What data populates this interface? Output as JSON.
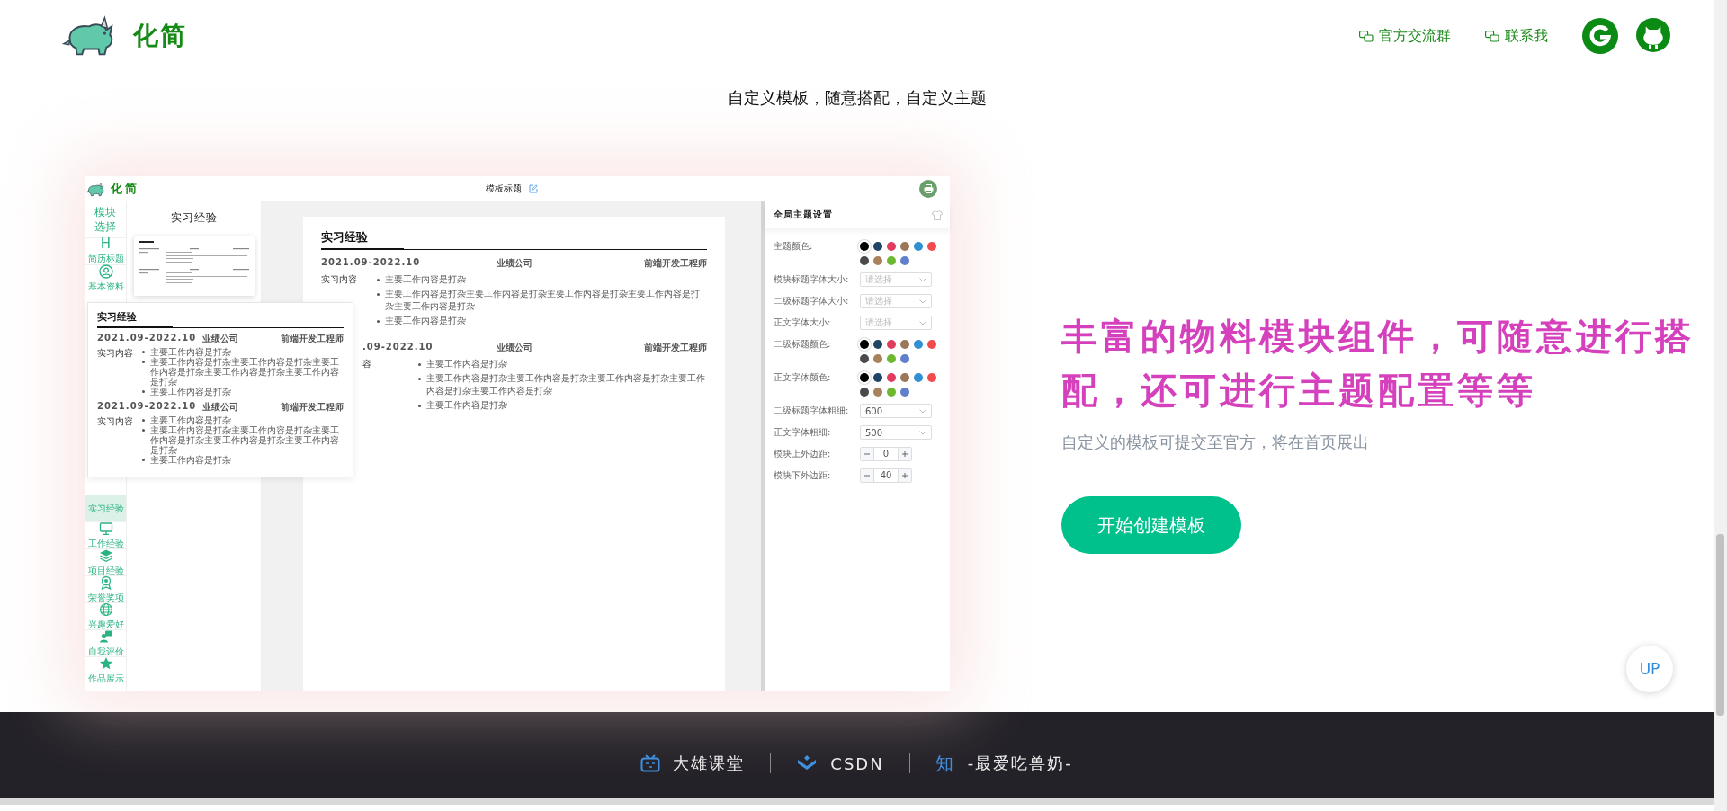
{
  "header": {
    "logo_text": "化简",
    "links": [
      {
        "label": "官方交流群"
      },
      {
        "label": "联系我"
      }
    ]
  },
  "tagline": "自定义模板，随意搭配，自定义主题",
  "preview": {
    "logo_text": "化简",
    "template_title": "模板标题",
    "sidebar": {
      "heading": "模块选择",
      "groups": [
        [
          {
            "kind": "glyph",
            "glyph": "H",
            "label": "简历标题",
            "selected": false
          },
          {
            "kind": "person",
            "label": "基本资料",
            "selected": false
          }
        ],
        [
          {
            "kind": "none",
            "label": "实习经验",
            "selected": true
          },
          {
            "kind": "monitor",
            "label": "工作经验",
            "selected": false
          },
          {
            "kind": "layers",
            "label": "项目经验",
            "selected": false
          },
          {
            "kind": "award",
            "label": "荣誉奖项",
            "selected": false
          },
          {
            "kind": "globe",
            "label": "兴趣爱好",
            "selected": false
          },
          {
            "kind": "chat",
            "label": "自我评价",
            "selected": false
          },
          {
            "kind": "star",
            "label": "作品展示",
            "selected": false
          }
        ]
      ]
    },
    "module_panel": {
      "title": "实习经验"
    },
    "document": {
      "heading": "实习经验",
      "entries": [
        {
          "period": "2021.09-2022.10",
          "company": "业绩公司",
          "role": "前端开发工程师",
          "label": "实习内容",
          "partly_hidden": false,
          "bullets": [
            "主要工作内容是打杂",
            "主要工作内容是打杂主要工作内容是打杂主要工作内容是打杂主要工作内容是打杂主要工作内容是打杂",
            "主要工作内容是打杂"
          ]
        },
        {
          "period": ".09-2022.10",
          "company": "业绩公司",
          "role": "前端开发工程师",
          "label": "容",
          "partly_hidden": true,
          "bullets": [
            "主要工作内容是打杂",
            "主要工作内容是打杂主要工作内容是打杂主要工作内容是打杂主要工作内容是打杂主要工作内容是打杂",
            "主要工作内容是打杂"
          ]
        }
      ]
    },
    "popup": {
      "heading": "实习经验",
      "entries": [
        {
          "period": "2021.09-2022.10",
          "company": "业绩公司",
          "role": "前端开发工程师",
          "label": "实习内容",
          "bullets": [
            "主要工作内容是打杂",
            "主要工作内容是打杂主要工作内容是打杂主要工作内容是打杂主要工作内容是打杂主要工作内容是打杂",
            "主要工作内容是打杂"
          ]
        },
        {
          "period": "2021.09-2022.10",
          "company": "业绩公司",
          "role": "前端开发工程师",
          "label": "实习内容",
          "bullets": [
            "主要工作内容是打杂",
            "主要工作内容是打杂主要工作内容是打杂主要工作内容是打杂主要工作内容是打杂主要工作内容是打杂",
            "主要工作内容是打杂"
          ]
        }
      ]
    },
    "theme_panel": {
      "title": "全局主题设置",
      "rows": [
        {
          "kind": "colors",
          "label": "主题颜色:",
          "swatches": [
            {
              "color": "#000000",
              "selected": true
            },
            {
              "color": "#1f4468",
              "selected": false
            },
            {
              "color": "#e03c5e",
              "selected": false
            },
            {
              "color": "#9a7858",
              "selected": false
            },
            {
              "color": "#2f90d4",
              "selected": false
            },
            {
              "color": "#f04c4c",
              "selected": false
            },
            {
              "color": "#4a4a4a",
              "selected": false
            },
            {
              "color": "#a8825a",
              "selected": false
            },
            {
              "color": "#6cb82e",
              "selected": false
            },
            {
              "color": "#6080cc",
              "selected": false
            }
          ]
        },
        {
          "kind": "select",
          "label": "模块标题字体大小:",
          "placeholder": "请选择"
        },
        {
          "kind": "select",
          "label": "二级标题字体大小:",
          "placeholder": "请选择"
        },
        {
          "kind": "select",
          "label": "正文字体大小:",
          "placeholder": "请选择"
        },
        {
          "kind": "colors",
          "label": "二级标题颜色:",
          "swatches": [
            {
              "color": "#000000",
              "selected": true
            },
            {
              "color": "#1f4468",
              "selected": false
            },
            {
              "color": "#e03c5e",
              "selected": false
            },
            {
              "color": "#9a7858",
              "selected": false
            },
            {
              "color": "#2f90d4",
              "selected": false
            },
            {
              "color": "#f04c4c",
              "selected": false
            },
            {
              "color": "#4a4a4a",
              "selected": false
            },
            {
              "color": "#a8825a",
              "selected": false
            },
            {
              "color": "#6cb82e",
              "selected": false
            },
            {
              "color": "#6080cc",
              "selected": false
            }
          ]
        },
        {
          "kind": "colors",
          "label": "正文字体颜色:",
          "swatches": [
            {
              "color": "#000000",
              "selected": true
            },
            {
              "color": "#1f4468",
              "selected": false
            },
            {
              "color": "#e03c5e",
              "selected": false
            },
            {
              "color": "#9a7858",
              "selected": false
            },
            {
              "color": "#2f90d4",
              "selected": false
            },
            {
              "color": "#f04c4c",
              "selected": false
            },
            {
              "color": "#4a4a4a",
              "selected": false
            },
            {
              "color": "#a8825a",
              "selected": false
            },
            {
              "color": "#6cb82e",
              "selected": false
            },
            {
              "color": "#6080cc",
              "selected": false
            }
          ]
        },
        {
          "kind": "select",
          "label": "二级标题字体粗细:",
          "value": "600"
        },
        {
          "kind": "select",
          "label": "正文字体粗细:",
          "value": "500"
        },
        {
          "kind": "stepper",
          "label": "模块上外边距:",
          "value": "0"
        },
        {
          "kind": "stepper",
          "label": "模块下外边距:",
          "value": "40"
        }
      ]
    }
  },
  "feature": {
    "headline": "丰富的物料模块组件，可随意进行搭配，还可进行主题配置等等",
    "description": "自定义的模板可提交至官方，将在首页展出",
    "button": "开始创建模板"
  },
  "up_button": "UP",
  "footer": {
    "links": [
      {
        "kind": "tv",
        "label": "大雄课堂"
      },
      {
        "kind": "csdn",
        "label": "CSDN"
      },
      {
        "kind": "mark",
        "mark": "知",
        "label": "-最爱吃兽奶-"
      }
    ]
  }
}
